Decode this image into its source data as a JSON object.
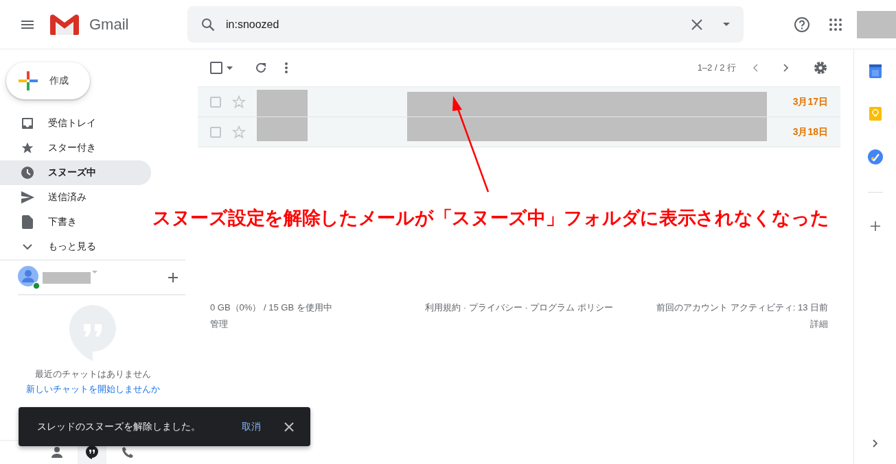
{
  "header": {
    "product_name": "Gmail",
    "search": {
      "value": "in:snoozed"
    }
  },
  "compose": {
    "label": "作成"
  },
  "nav": [
    {
      "kind": "inbox",
      "label": "受信トレイ",
      "selected": false
    },
    {
      "kind": "starred",
      "label": "スター付き",
      "selected": false
    },
    {
      "kind": "snoozed",
      "label": "スヌーズ中",
      "selected": true
    },
    {
      "kind": "sent",
      "label": "送信済み",
      "selected": false
    },
    {
      "kind": "drafts",
      "label": "下書き",
      "selected": false
    },
    {
      "kind": "more",
      "label": "もっと見る",
      "selected": false
    }
  ],
  "chat": {
    "empty_message": "最近のチャットはありません",
    "start_link": "新しいチャットを開始しませんか"
  },
  "toolbar": {
    "select_all_checked": false,
    "page_range": "1–2 / 2 行"
  },
  "messages": [
    {
      "checked": false,
      "starred": false,
      "date": "3月17日"
    },
    {
      "checked": false,
      "starred": false,
      "date": "3月18日"
    }
  ],
  "footer": {
    "storage": "0 GB（0%） / 15 GB を使用中",
    "manage": "管理",
    "policies": "利用規約 · プライバシー · プログラム ポリシー",
    "activity": "前回のアカウント アクティビティ: 13 日前",
    "details": "詳細"
  },
  "snackbar": {
    "message": "スレッドのスヌーズを解除しました。",
    "action": "取消"
  },
  "annotation": {
    "text": "スヌーズ設定を解除したメールが「スヌーズ中」フォルダに表示されなくなった"
  }
}
